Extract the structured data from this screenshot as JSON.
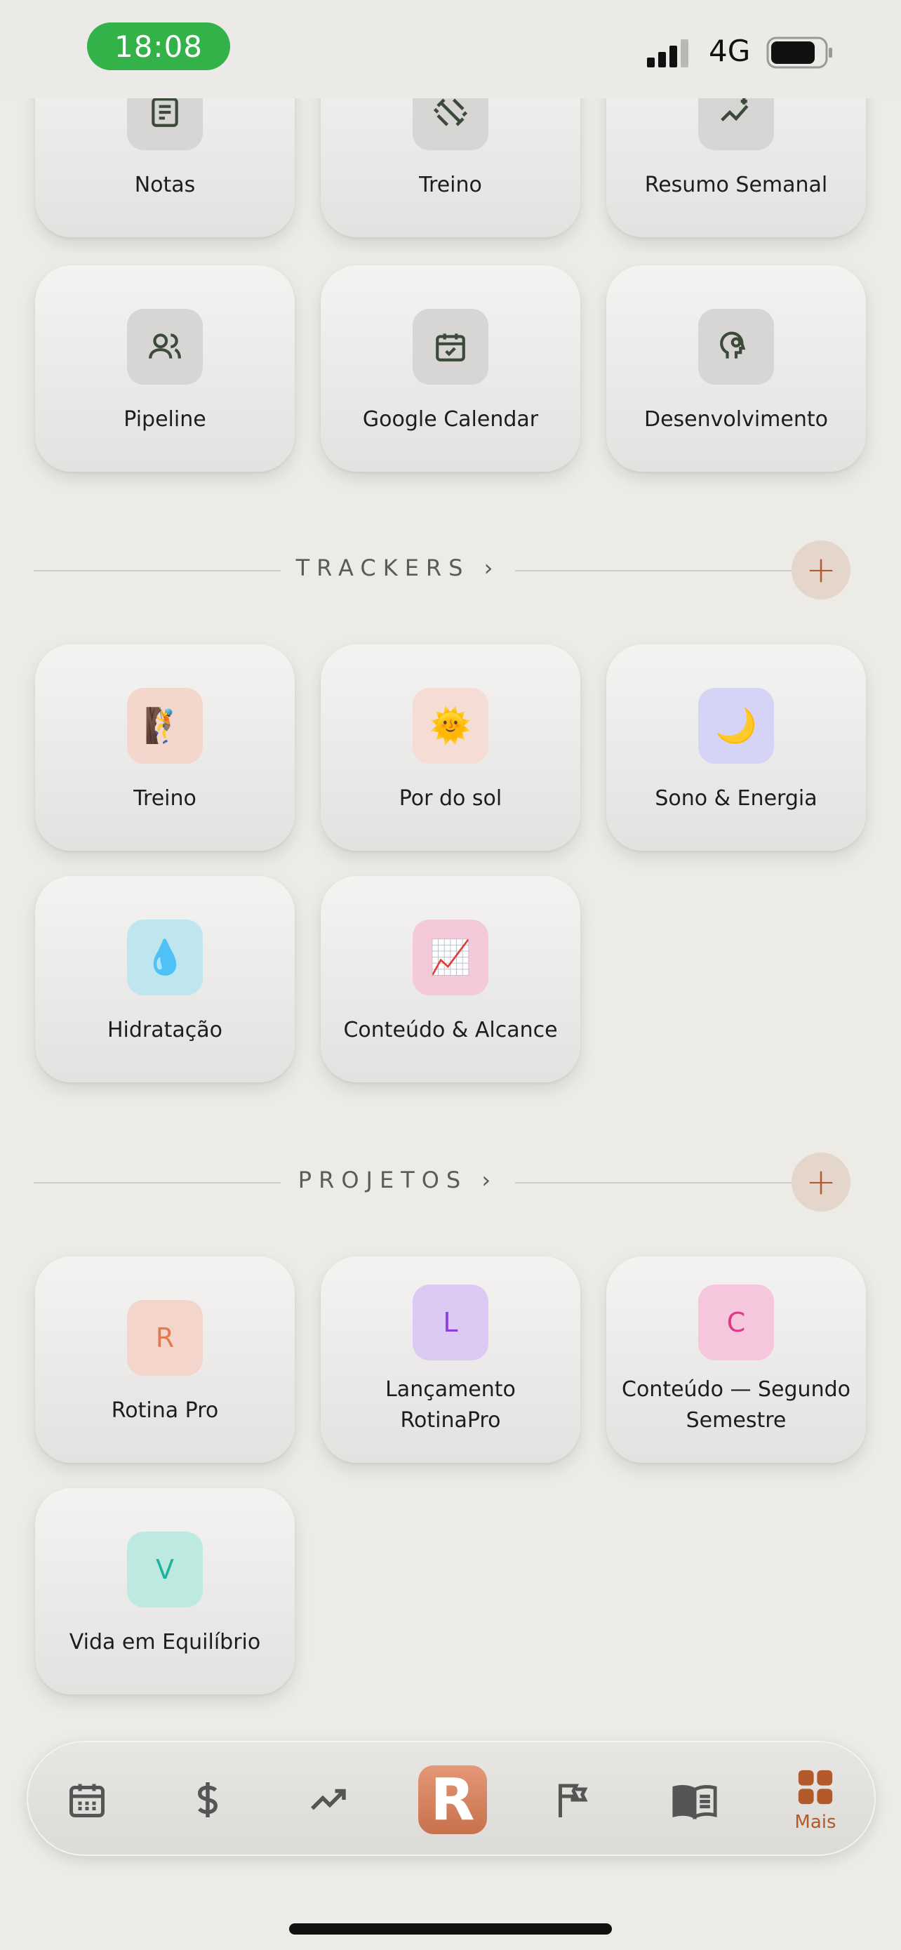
{
  "status_bar": {
    "time": "18:08",
    "network": "4G"
  },
  "quick_cards": [
    {
      "label": "Notas",
      "icon": "notes-icon"
    },
    {
      "label": "Treino",
      "icon": "dumbbell-icon"
    },
    {
      "label": "Resumo Semanal",
      "icon": "trend-sparkle-icon"
    },
    {
      "label": "Pipeline",
      "icon": "users-icon"
    },
    {
      "label": "Google Calendar",
      "icon": "calendar-check-icon"
    },
    {
      "label": "Desenvolvimento",
      "icon": "head-gear-icon"
    }
  ],
  "trackers": {
    "title": "TRACKERS ›",
    "add": "+",
    "items": [
      {
        "label": "Treino",
        "emoji": "🧗",
        "bg": "#f3d6cc"
      },
      {
        "label": "Por do sol",
        "emoji": "🌞",
        "bg": "#f5ddd5"
      },
      {
        "label": "Sono & Energia",
        "emoji": "🌙",
        "bg": "#d5d4f6"
      },
      {
        "label": "Hidratação",
        "emoji": "💧",
        "bg": "#bfe6ee"
      },
      {
        "label": "Conteúdo & Alcance",
        "emoji": "📈",
        "bg": "#f4c9da"
      }
    ]
  },
  "projects": {
    "title": "PROJETOS ›",
    "add": "+",
    "items": [
      {
        "label": "Rotina Pro",
        "letter": "R",
        "bg": "#f3d5cb",
        "color": "#e07b4f"
      },
      {
        "label": "Lançamento RotinaPro",
        "letter": "L",
        "bg": "#dccaf4",
        "color": "#8a3fe0"
      },
      {
        "label": "Conteúdo — Segundo Semestre",
        "letter": "C",
        "bg": "#f5c6dc",
        "color": "#e0398a"
      },
      {
        "label": "Vida em Equilíbrio",
        "letter": "V",
        "bg": "#bdeae0",
        "color": "#1fb39b"
      }
    ]
  },
  "tab_bar": {
    "tabs": [
      "calendar-icon",
      "dollar-icon",
      "trend-icon",
      "app-logo",
      "flag-icon",
      "book-icon",
      "grid-icon"
    ],
    "logo_letter": "R",
    "more_label": "Mais",
    "accent": "#b25a2c"
  }
}
